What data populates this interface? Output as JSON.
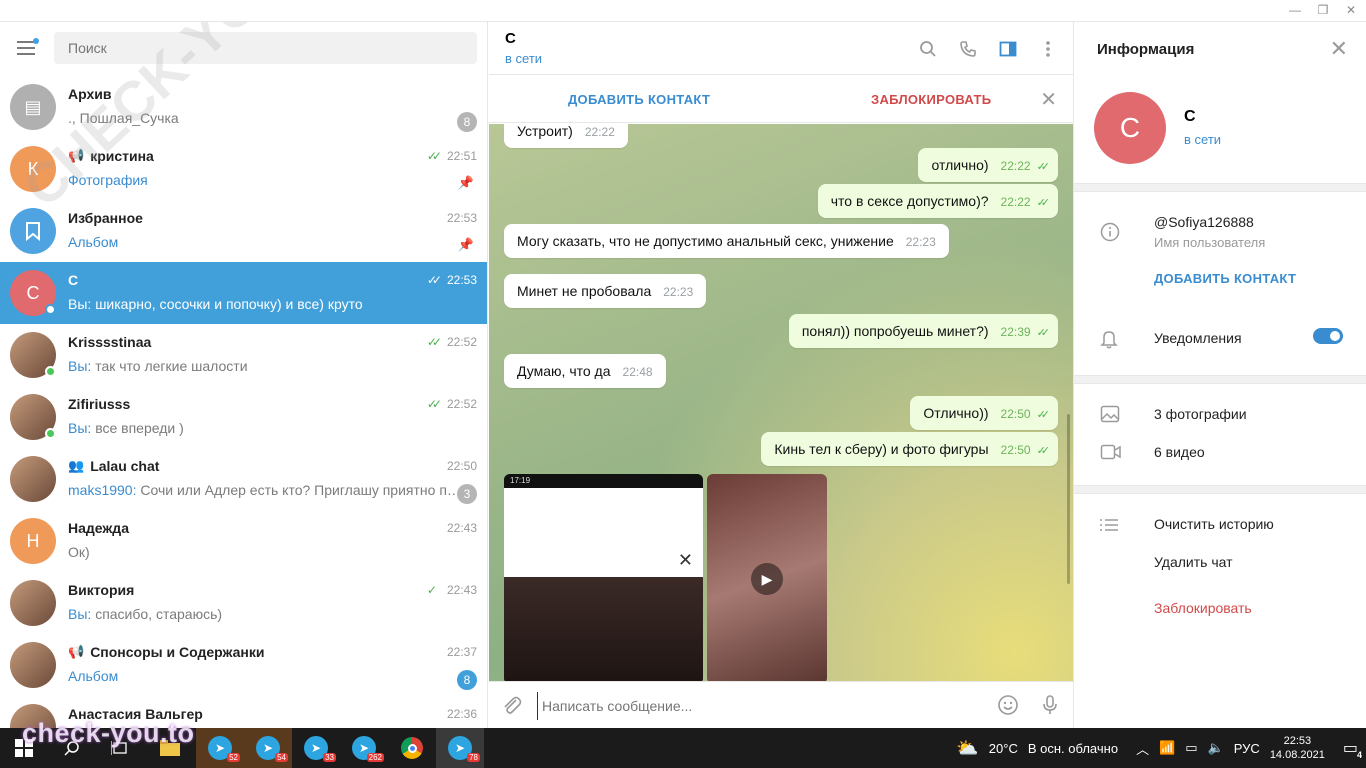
{
  "titlebar": {
    "min": "—",
    "max": "❐",
    "close": "✕"
  },
  "left": {
    "search_placeholder": "Поиск",
    "chats": [
      {
        "name": "Архив",
        "preview_from": "",
        "preview": "., Пошлая_Сучка",
        "time": "",
        "badge": "8",
        "avatar_letter": "",
        "avatar_color": "#b0b0b0",
        "icon": "archive-icon"
      },
      {
        "name": "кристина",
        "preview_from": "",
        "preview": "Фотография",
        "time": "22:51",
        "badge": "",
        "avatar_letter": "К",
        "avatar_color": "#f09a5a",
        "icon": "megaphone-icon",
        "read": true,
        "pinned": true,
        "preview_blue": true
      },
      {
        "name": "Избранное",
        "preview_from": "",
        "preview": "Альбом",
        "time": "22:53",
        "badge": "",
        "avatar_letter": "",
        "avatar_color": "#4fa3e0",
        "icon": "bookmark-icon",
        "pinned": true,
        "preview_blue": true
      },
      {
        "name": "С",
        "preview_from": "Вы:",
        "preview": "шикарно, сосочки и попочку) и все) круто",
        "time": "22:53",
        "badge": "",
        "avatar_letter": "С",
        "avatar_color": "#e06a6e",
        "read": true,
        "active": true,
        "online": true
      },
      {
        "name": "Krisssstinaa",
        "preview_from": "Вы:",
        "preview": "так что легкие шалости",
        "time": "22:52",
        "badge": "",
        "avatar_letter": "",
        "photo": true,
        "read": true,
        "online": true
      },
      {
        "name": "Zifiriusss",
        "preview_from": "Вы:",
        "preview": "все впереди )",
        "time": "22:52",
        "badge": "",
        "avatar_letter": "",
        "photo": true,
        "read": true,
        "online": true
      },
      {
        "name": "Lalau chat",
        "preview_from": "maks1990:",
        "preview": "Сочи или Адлер есть кто? Приглашу приятно про...",
        "time": "22:50",
        "badge": "3",
        "avatar_letter": "",
        "photo": true,
        "icon": "group-icon"
      },
      {
        "name": "Надежда",
        "preview_from": "",
        "preview": "Ок)",
        "time": "22:43",
        "badge": "",
        "avatar_letter": "Н",
        "avatar_color": "#f09a5a"
      },
      {
        "name": "Виктория",
        "preview_from": "Вы:",
        "preview": "спасибо, стараюсь)",
        "time": "22:43",
        "badge": "",
        "avatar_letter": "",
        "photo": true,
        "read_single": true
      },
      {
        "name": "Спонсоры и Содержанки",
        "preview_from": "",
        "preview": "Альбом",
        "time": "22:37",
        "badge": "8",
        "badge_blue": true,
        "avatar_letter": "",
        "photo": true,
        "icon": "megaphone-icon",
        "preview_blue": true
      },
      {
        "name": "Анастасия Вальгер",
        "preview_from": "",
        "preview": "",
        "time": "22:36",
        "badge": "",
        "avatar_letter": "",
        "photo": true
      }
    ]
  },
  "middle": {
    "title": "С",
    "status": "в сети",
    "add_contact": "ДОБАВИТЬ КОНТАКТ",
    "block": "ЗАБЛОКИРОВАТЬ",
    "messages": [
      {
        "dir": "in",
        "text": "Устроит)",
        "time": "22:22"
      },
      {
        "dir": "out",
        "text": "отлично)",
        "time": "22:22"
      },
      {
        "dir": "out",
        "text": "что в сексе допустимо)?",
        "time": "22:22"
      },
      {
        "dir": "in",
        "text": "Могу сказать, что не допустимо анальный секс, унижение",
        "time": "22:23"
      },
      {
        "dir": "in",
        "text": "Минет не пробовала",
        "time": "22:23"
      },
      {
        "dir": "out",
        "text": "понял)) попробуешь минет?)",
        "time": "22:39"
      },
      {
        "dir": "in",
        "text": "Думаю, что да",
        "time": "22:48"
      },
      {
        "dir": "out",
        "text": "Отлично))",
        "time": "22:50"
      },
      {
        "dir": "out",
        "text": "Кинь тел к сберу) и фото фигуры",
        "time": "22:50"
      }
    ],
    "media_statusbar": "17:19",
    "composer_placeholder": "Написать сообщение..."
  },
  "right": {
    "title": "Информация",
    "name": "С",
    "avatar_letter": "С",
    "status": "в сети",
    "username": "@Sofiya126888",
    "username_label": "Имя пользователя",
    "add_contact": "ДОБАВИТЬ КОНТАКТ",
    "notifications": "Уведомления",
    "photos": "3 фотографии",
    "videos": "6 видео",
    "clear_history": "Очистить историю",
    "delete_chat": "Удалить чат",
    "block": "Заблокировать"
  },
  "taskbar": {
    "apps": [
      {
        "count": "52"
      },
      {
        "count": "54"
      },
      {
        "count": "33"
      },
      {
        "count": "262"
      },
      {
        "count": ""
      },
      {
        "count": "78"
      }
    ],
    "weather_temp": "20°C",
    "weather_text": "В осн. облачно",
    "lang": "РУС",
    "time": "22:53",
    "date": "14.08.2021",
    "notif_count": "4"
  },
  "watermark": "check-you.to",
  "watermark_diag": "CHECK-YOU.ME"
}
